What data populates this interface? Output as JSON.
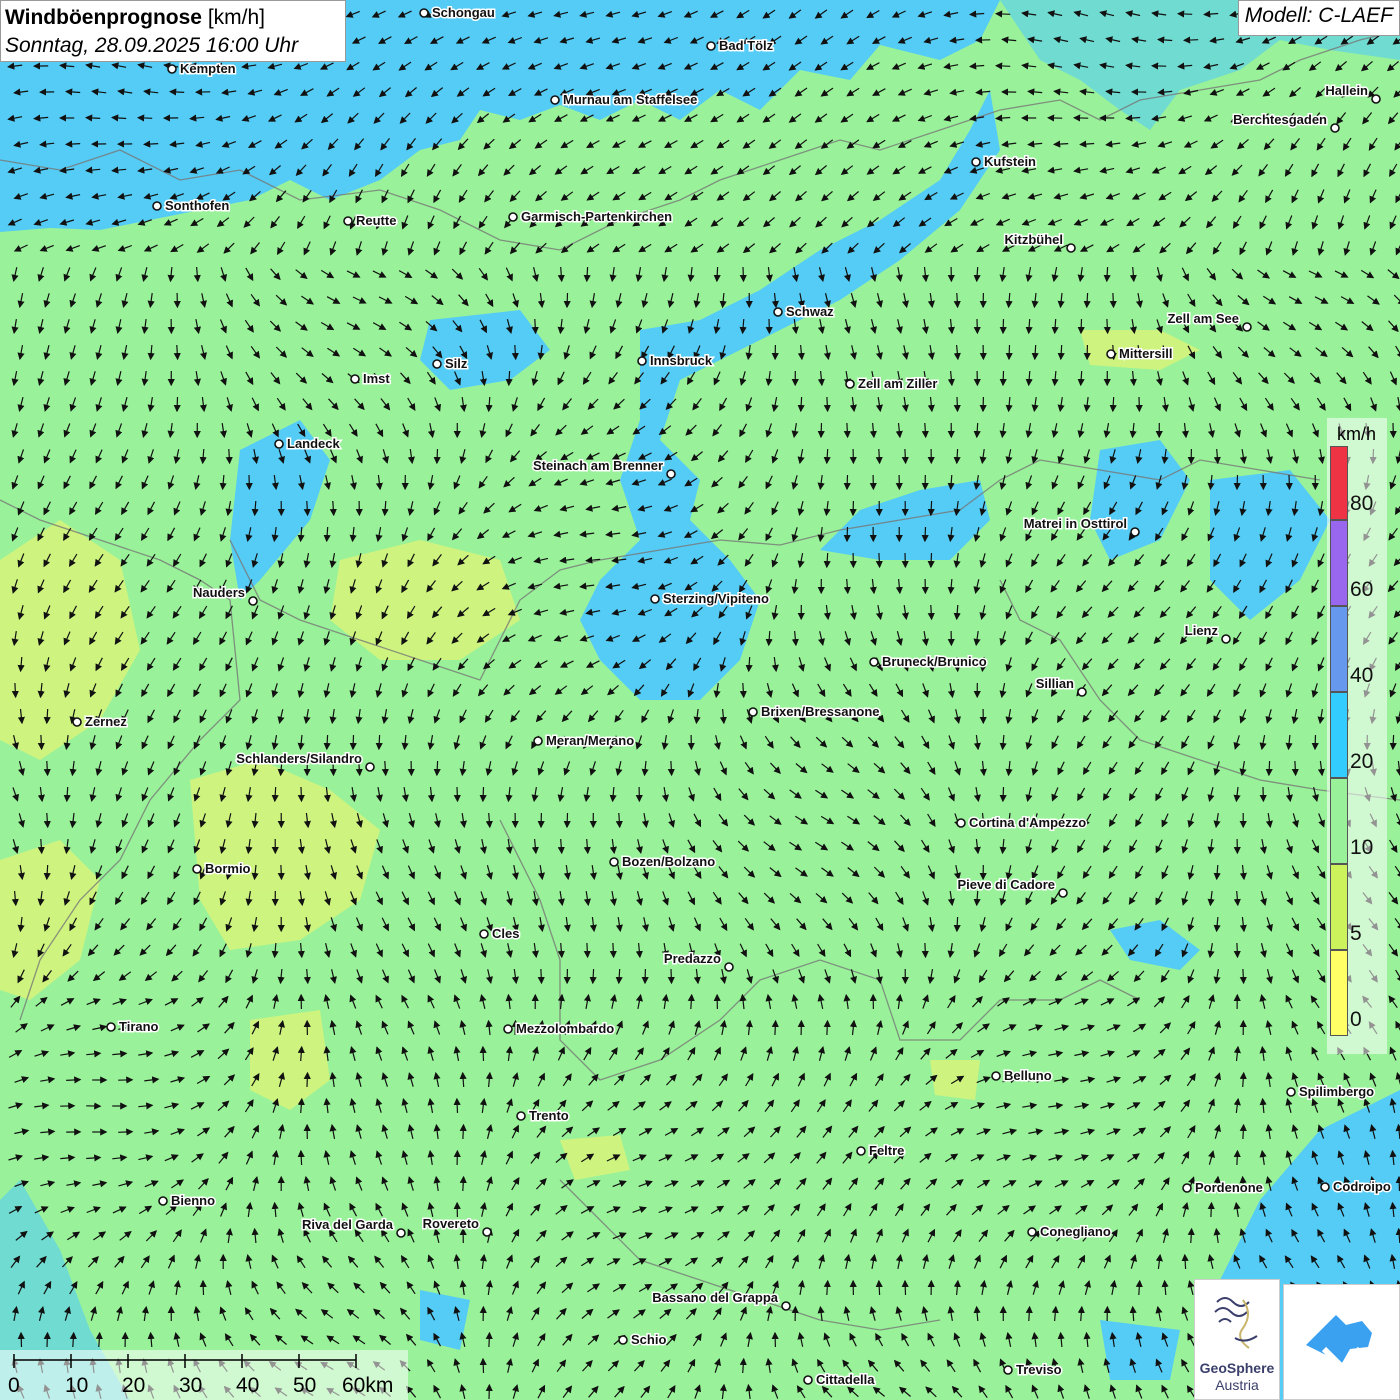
{
  "title": {
    "main": "Windböenprognose",
    "unit": "[km/h]",
    "date": "Sonntag, 28.09.2025 16:00 Uhr"
  },
  "model": "Modell: C-LAEF",
  "legend": {
    "unit": "km/h",
    "classes": [
      {
        "from": 0,
        "to": 5,
        "color": "#ffff66"
      },
      {
        "from": 5,
        "to": 10,
        "color": "#ccf25c"
      },
      {
        "from": 10,
        "to": 20,
        "color": "#99f299"
      },
      {
        "from": 20,
        "to": 40,
        "color": "#33ccff"
      },
      {
        "from": 40,
        "to": 60,
        "color": "#6699ee"
      },
      {
        "from": 60,
        "to": 80,
        "color": "#9966ee"
      },
      {
        "from": 80,
        "to": 100,
        "color": "#ee3344"
      }
    ],
    "labels": [
      "0",
      "5",
      "10",
      "20",
      "40",
      "60",
      "80"
    ]
  },
  "scale": {
    "labels": [
      "0",
      "10",
      "20",
      "30",
      "40",
      "50",
      "60km"
    ]
  },
  "logos": {
    "geosphere_line1": "GeoSphere",
    "geosphere_line2": "Austria",
    "geosphere_icon": "geosphere-logo-icon",
    "app_icon": "app-logo-icon"
  },
  "cities": [
    "Schongau",
    "Bad Tölz",
    "Kempten",
    "Murnau am Staffelsee",
    "Hallein",
    "Berchtesgaden",
    "Kufstein",
    "Sonthofen",
    "Reutte",
    "Garmisch-Partenkirchen",
    "Kitzbühel",
    "Schwaz",
    "Zell am See",
    "Mittersill",
    "Innsbruck",
    "Silz",
    "Imst",
    "Zell am Ziller",
    "Landeck",
    "Steinach am Brenner",
    "Matrei in Osttirol",
    "Nauders",
    "Sterzing/Vipiteno",
    "Lienz",
    "Bruneck/Brunico",
    "Sillian",
    "Zernez",
    "Brixen/Bressanone",
    "Meran/Merano",
    "Schlanders/Silandro",
    "Cortina d'Ampezzo",
    "Bozen/Bolzano",
    "Bormio",
    "Pieve di Cadore",
    "Cles",
    "Predazzo",
    "Tirano",
    "Mezzolombardo",
    "Belluno",
    "Spilimbergo",
    "Trento",
    "Feltre",
    "Bienno",
    "Pordenone",
    "Codroipo",
    "Riva del Garda",
    "Rovereto",
    "Conegliano",
    "Bassano del Grappa",
    "Schio",
    "Treviso",
    "Cittadella"
  ],
  "wind_field": {
    "classes_shown": [
      "5-10",
      "10-20",
      "20-40"
    ],
    "dominant_class": "10-20"
  }
}
